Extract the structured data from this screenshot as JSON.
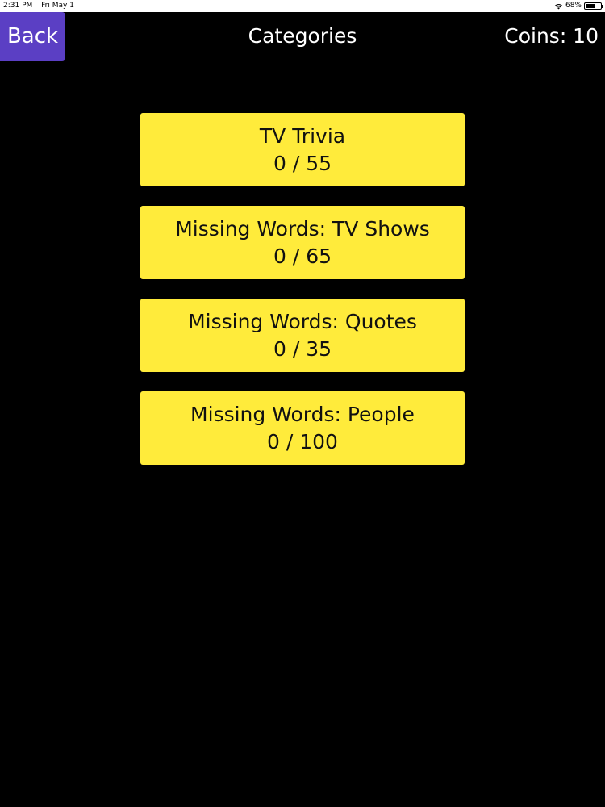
{
  "status_bar": {
    "time": "2:31 PM",
    "date": "Fri May 1",
    "battery": "68%",
    "battery_level": 0.68
  },
  "header": {
    "back_label": "Back",
    "title": "Categories",
    "coins_label": "Coins: 10"
  },
  "categories": [
    {
      "name": "TV Trivia",
      "progress": "0 / 55"
    },
    {
      "name": "Missing Words: TV Shows",
      "progress": "0 / 65"
    },
    {
      "name": "Missing Words: Quotes",
      "progress": "0 / 35"
    },
    {
      "name": "Missing Words: People",
      "progress": "0 / 100"
    }
  ],
  "colors": {
    "background": "#000000",
    "back_button": "#5b3fc4",
    "card": "#ffeb3b"
  },
  "icons": {
    "wifi": "wifi-icon",
    "battery": "battery-icon"
  }
}
